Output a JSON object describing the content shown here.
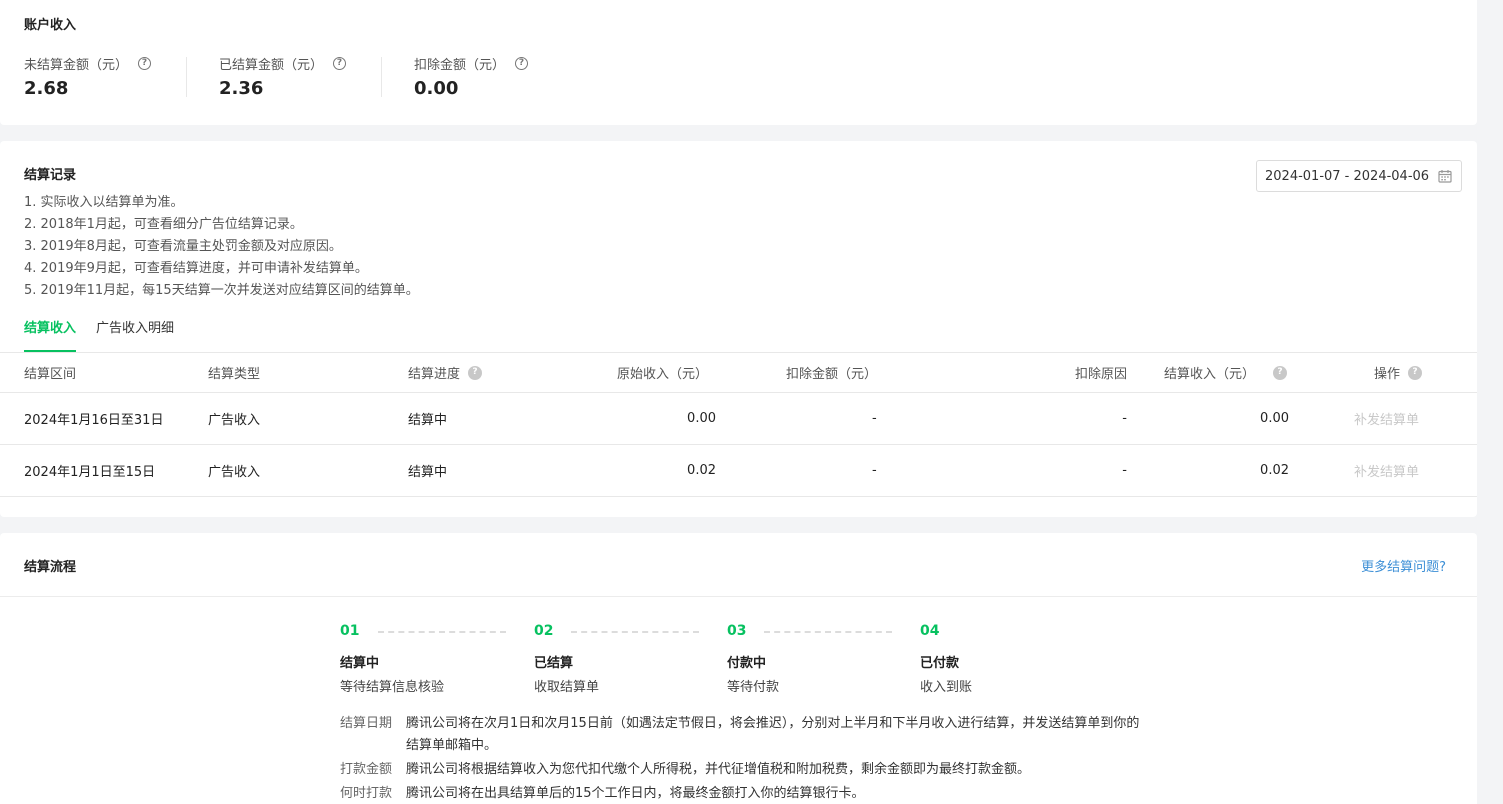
{
  "account_income": {
    "title": "账户收入",
    "metrics": [
      {
        "label": "未结算金额（元）",
        "value": "2.68"
      },
      {
        "label": "已结算金额（元）",
        "value": "2.36"
      },
      {
        "label": "扣除金额（元）",
        "value": "0.00"
      }
    ]
  },
  "settlement_records": {
    "title": "结算记录",
    "date_range": "2024-01-07 - 2024-04-06",
    "notes": [
      "1. 实际收入以结算单为准。",
      "2. 2018年1月起，可查看细分广告位结算记录。",
      "3. 2019年8月起，可查看流量主处罚金额及对应原因。",
      "4. 2019年9月起，可查看结算进度，并可申请补发结算单。",
      "5. 2019年11月起，每15天结算一次并发送对应结算区间的结算单。"
    ],
    "tabs": [
      {
        "label": "结算收入",
        "active": true
      },
      {
        "label": "广告收入明细",
        "active": false
      }
    ],
    "columns": [
      "结算区间",
      "结算类型",
      "结算进度",
      "原始收入（元）",
      "扣除金额（元）",
      "扣除原因",
      "结算收入（元）",
      "操作"
    ],
    "rows": [
      {
        "period": "2024年1月16日至31日",
        "type": "广告收入",
        "progress": "结算中",
        "original": "0.00",
        "deducted": "-",
        "reason": "-",
        "income": "0.00",
        "action": "补发结算单"
      },
      {
        "period": "2024年1月1日至15日",
        "type": "广告收入",
        "progress": "结算中",
        "original": "0.02",
        "deducted": "-",
        "reason": "-",
        "income": "0.02",
        "action": "补发结算单"
      }
    ]
  },
  "settlement_flow": {
    "title": "结算流程",
    "more_link": "更多结算问题?",
    "steps": [
      {
        "num": "01",
        "title": "结算中",
        "desc": "等待结算信息核验"
      },
      {
        "num": "02",
        "title": "已结算",
        "desc": "收取结算单"
      },
      {
        "num": "03",
        "title": "付款中",
        "desc": "等待付款"
      },
      {
        "num": "04",
        "title": "已付款",
        "desc": "收入到账"
      }
    ],
    "info": [
      {
        "label": "结算日期",
        "text": "腾讯公司将在次月1日和次月15日前（如遇法定节假日，将会推迟），分别对上半月和下半月收入进行结算，并发送结算单到你的结算单邮箱中。"
      },
      {
        "label": "打款金额",
        "text": "腾讯公司将根据结算收入为您代扣代缴个人所得税，并代征增值税和附加税费，剩余金额即为最终打款金额。"
      },
      {
        "label": "何时打款",
        "text": "腾讯公司将在出具结算单后的15个工作日内，将最终金额打入你的结算银行卡。"
      }
    ]
  },
  "colors": {
    "accent": "#07c160",
    "link": "#3d8fd6"
  },
  "icons": {
    "help": "question-circle-icon",
    "calendar": "calendar-icon"
  }
}
